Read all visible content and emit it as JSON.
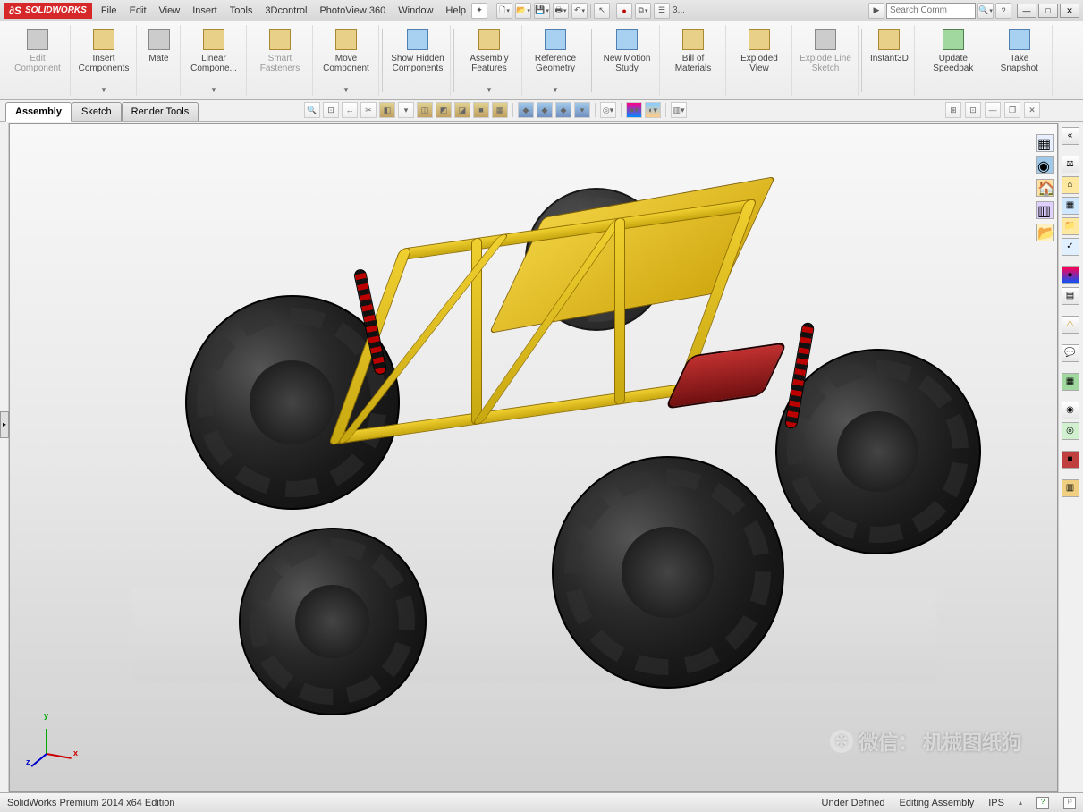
{
  "app": {
    "logo": "SOLIDWORKS"
  },
  "menu": [
    "File",
    "Edit",
    "View",
    "Insert",
    "Tools",
    "3Dcontrol",
    "PhotoView 360",
    "Window",
    "Help"
  ],
  "toolbar_quick": {
    "doc3": "3..."
  },
  "search": {
    "placeholder": "Search Comm"
  },
  "ribbon": [
    {
      "label": "Edit Component",
      "dim": true,
      "icon": "gray"
    },
    {
      "label": "Insert Components",
      "drop": true,
      "icon": ""
    },
    {
      "label": "Mate",
      "icon": "gray"
    },
    {
      "label": "Linear Compone...",
      "drop": true,
      "icon": ""
    },
    {
      "label": "Smart Fasteners",
      "dim": true,
      "icon": ""
    },
    {
      "label": "Move Component",
      "drop": true,
      "icon": ""
    },
    {
      "label": "Show Hidden Components",
      "icon": "blue"
    },
    {
      "label": "Assembly Features",
      "drop": true,
      "icon": ""
    },
    {
      "label": "Reference Geometry",
      "drop": true,
      "icon": "blue"
    },
    {
      "label": "New Motion Study",
      "icon": "blue"
    },
    {
      "label": "Bill of Materials",
      "icon": ""
    },
    {
      "label": "Exploded View",
      "icon": ""
    },
    {
      "label": "Explode Line Sketch",
      "dim": true,
      "icon": "gray"
    },
    {
      "label": "Instant3D",
      "icon": ""
    },
    {
      "label": "Update Speedpak",
      "icon": "green"
    },
    {
      "label": "Take Snapshot",
      "icon": "blue"
    }
  ],
  "tabs": [
    "Assembly",
    "Sketch",
    "Render Tools"
  ],
  "active_tab": "Assembly",
  "triad": {
    "x": "x",
    "y": "y",
    "z": "z"
  },
  "watermark": {
    "prefix": "微信：",
    "text": "机械图纸狗"
  },
  "status": {
    "left": "SolidWorks Premium 2014 x64 Edition",
    "define": "Under Defined",
    "mode": "Editing Assembly",
    "units": "IPS"
  }
}
